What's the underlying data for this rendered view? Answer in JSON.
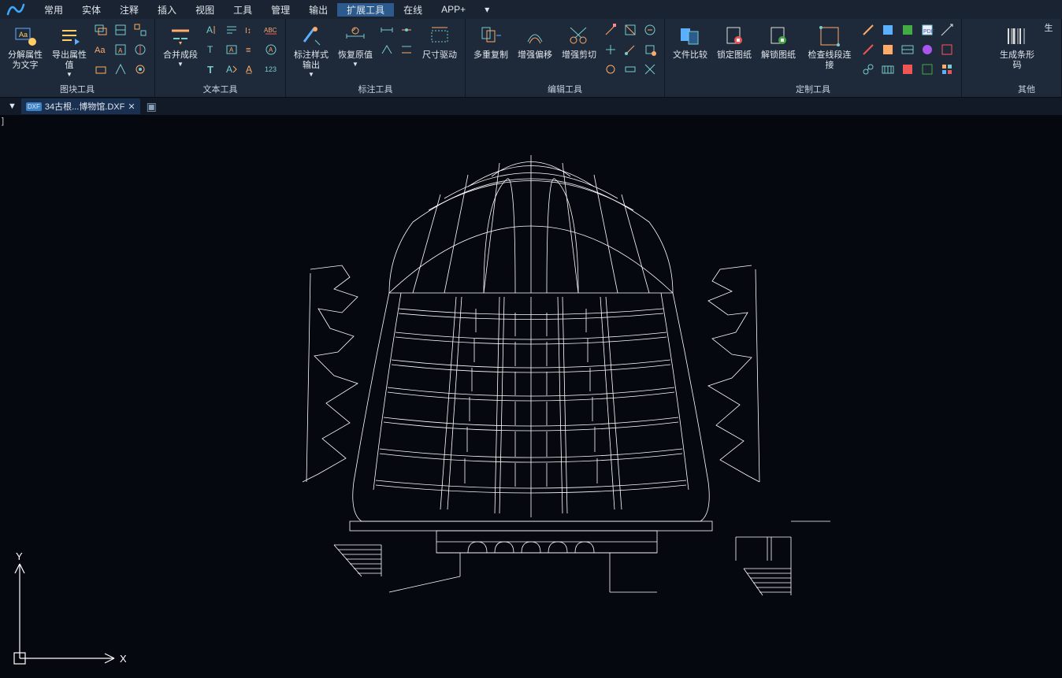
{
  "menu": {
    "items": [
      "常用",
      "实体",
      "注释",
      "插入",
      "视图",
      "工具",
      "管理",
      "输出",
      "扩展工具",
      "在线",
      "APP+"
    ],
    "active_index": 8
  },
  "ribbon": {
    "groups": [
      {
        "label": "图块工具",
        "big": [
          {
            "name": "decompose-attr",
            "label": "分解属性为文字"
          },
          {
            "name": "export-attr",
            "label": "导出属性值"
          }
        ],
        "smallcols": 3,
        "smallcount": 9
      },
      {
        "label": "文本工具",
        "big": [
          {
            "name": "merge-paragraph",
            "label": "合并成段"
          }
        ],
        "smallcols": 4,
        "smallcount": 12
      },
      {
        "label": "标注工具",
        "big": [
          {
            "name": "dim-style-out",
            "label": "标注样式输出"
          },
          {
            "name": "restore-value",
            "label": "恢复原值"
          },
          {
            "name": "dim-drive",
            "label": "尺寸驱动"
          }
        ],
        "smallcols": 2,
        "smallcount": 4
      },
      {
        "label": "编辑工具",
        "big": [
          {
            "name": "multi-copy",
            "label": "多重复制"
          },
          {
            "name": "enh-offset",
            "label": "增强偏移"
          },
          {
            "name": "enh-trim",
            "label": "增强剪切"
          }
        ],
        "smallcols": 3,
        "smallcount": 9
      },
      {
        "label": "定制工具",
        "big": [
          {
            "name": "file-compare",
            "label": "文件比较"
          },
          {
            "name": "lock-dwg",
            "label": "锁定图纸"
          },
          {
            "name": "unlock-dwg",
            "label": "解锁图纸"
          },
          {
            "name": "check-line",
            "label": "检查线段连接"
          }
        ],
        "smallcols": 0,
        "smallcount": 0
      },
      {
        "label": "",
        "big": [],
        "smallcols": 4,
        "smallcount": 12
      },
      {
        "label": "其他",
        "big": [
          {
            "name": "barcode",
            "label": "生成条形码"
          },
          {
            "name": "gen",
            "label": "生"
          }
        ],
        "smallcols": 0,
        "smallcount": 0
      }
    ]
  },
  "tabs": {
    "file_name": "34古根...博物馆.DXF",
    "file_ext_badge": "DXF"
  },
  "ucs": {
    "x_label": "X",
    "y_label": "Y"
  }
}
